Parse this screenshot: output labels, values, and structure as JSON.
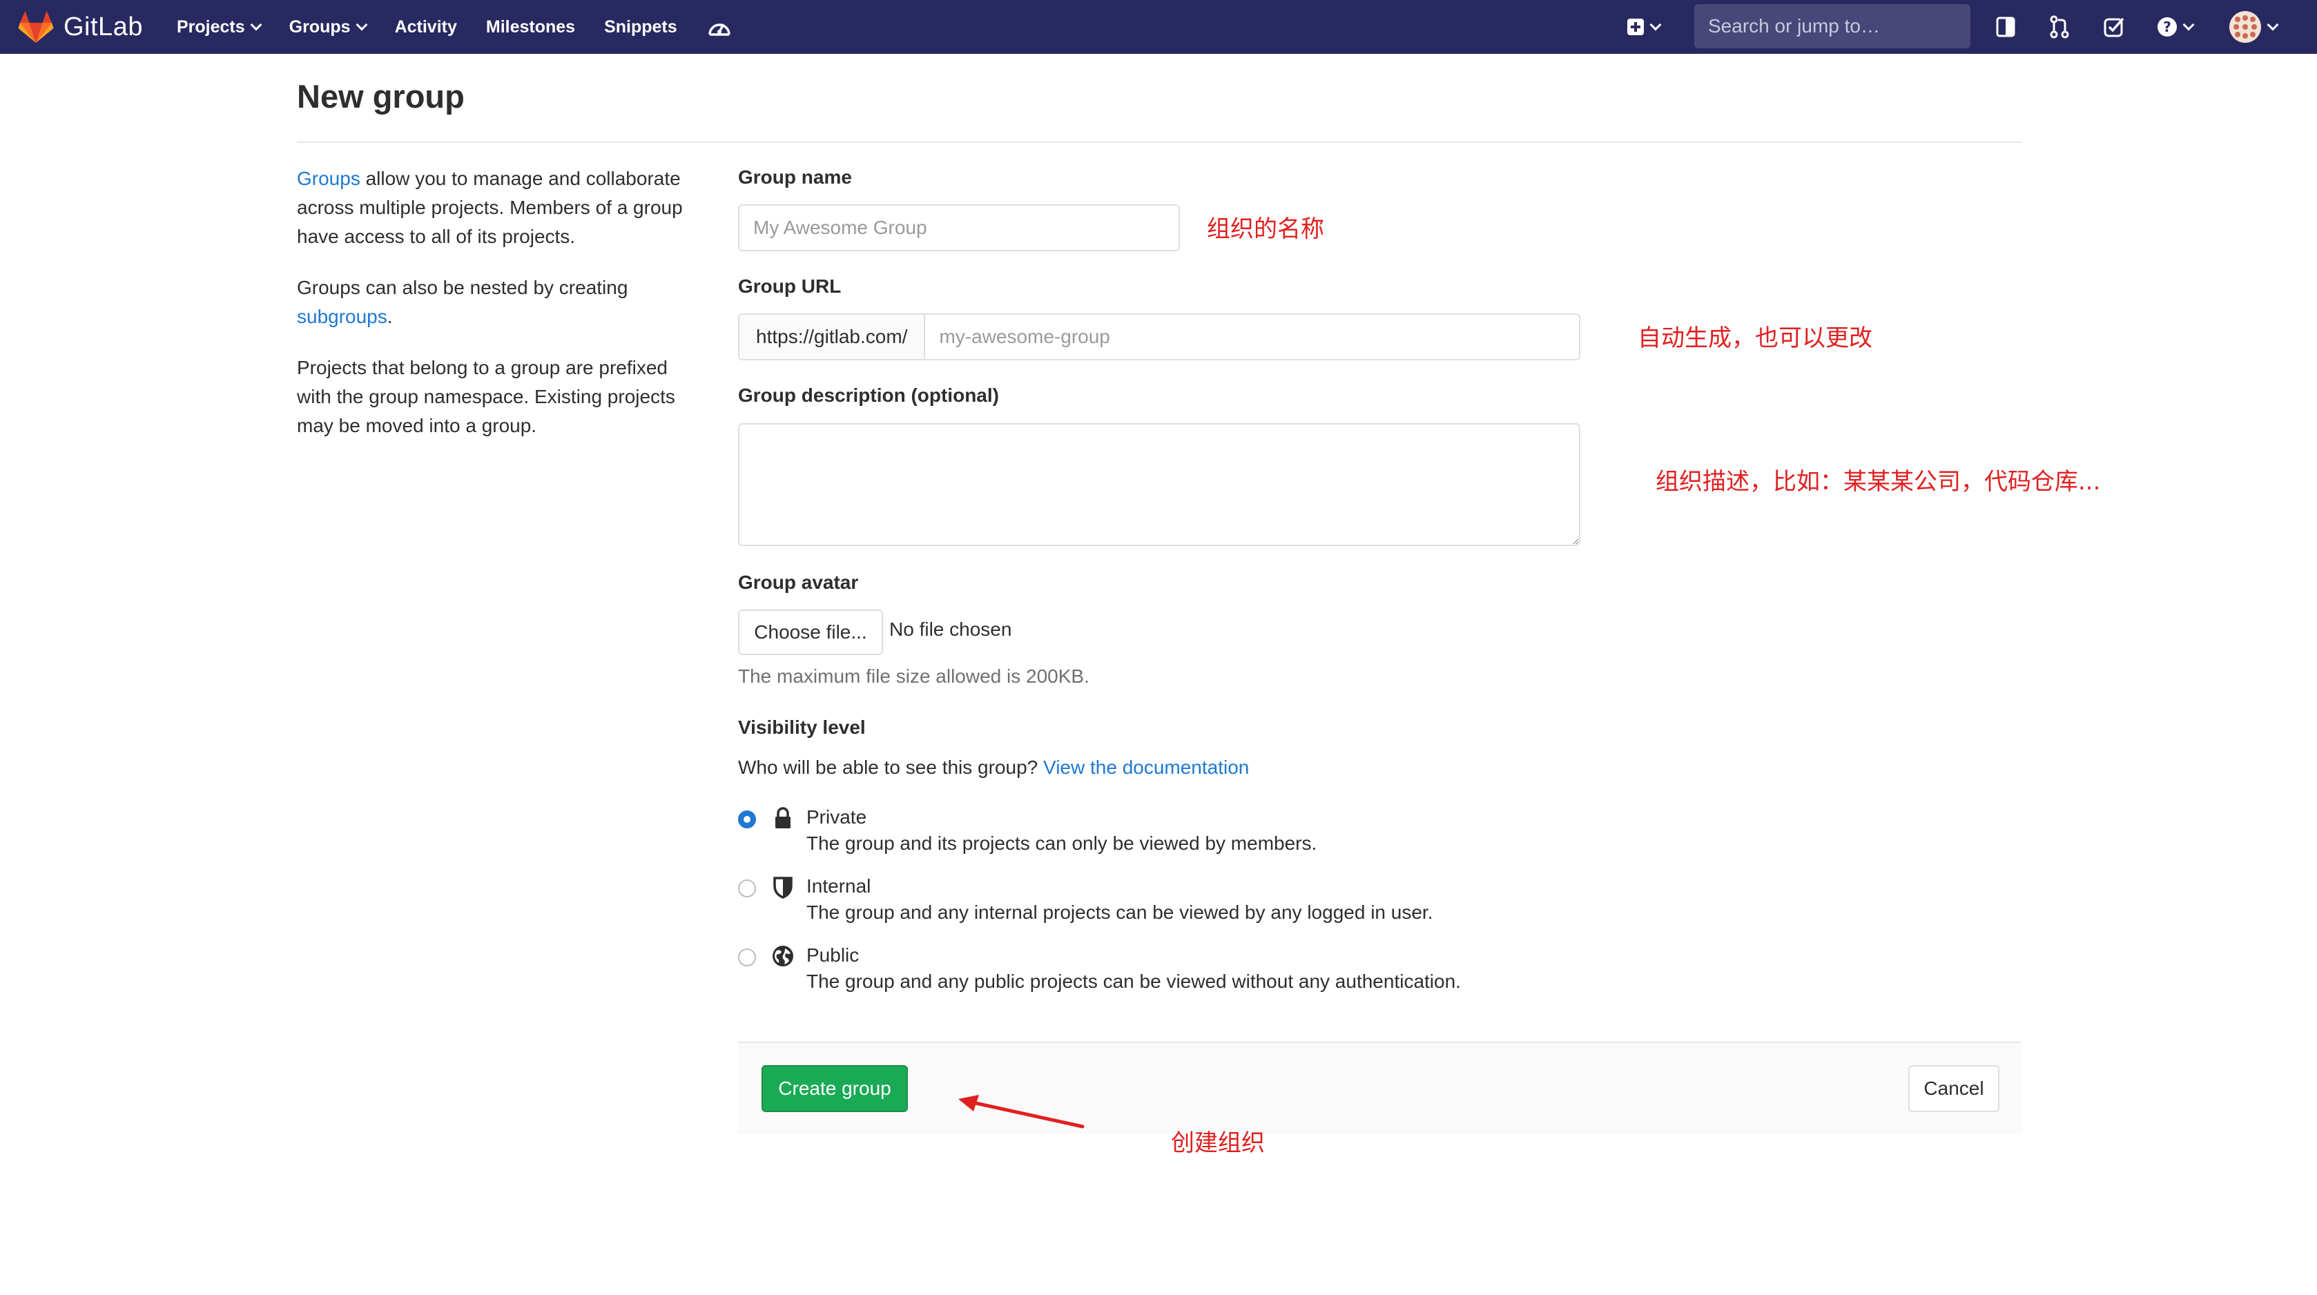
{
  "navbar": {
    "brand": "GitLab",
    "links": [
      {
        "label": "Projects",
        "has_dropdown": true
      },
      {
        "label": "Groups",
        "has_dropdown": true
      },
      {
        "label": "Activity",
        "has_dropdown": false
      },
      {
        "label": "Milestones",
        "has_dropdown": false
      },
      {
        "label": "Snippets",
        "has_dropdown": false
      }
    ],
    "extra_icon": "admin-dashboard-icon",
    "search_placeholder": "Search or jump to…",
    "right_icons": [
      "new-plus-icon",
      "sidebar-toggle-icon",
      "merge-request-icon",
      "todo-check-icon",
      "help-icon",
      "user-avatar"
    ]
  },
  "page": {
    "title": "New group"
  },
  "sidebar": {
    "p1_link": "Groups",
    "p1_text": " allow you to manage and collaborate across multiple projects. Members of a group have access to all of its projects.",
    "p2_text": "Groups can also be nested by creating ",
    "p2_link": "subgroups",
    "p2_end": ".",
    "p3_text": "Projects that belong to a group are prefixed with the group namespace. Existing projects may be moved into a group."
  },
  "form": {
    "group_name_label": "Group name",
    "group_name_placeholder": "My Awesome Group",
    "group_url_label": "Group URL",
    "group_url_prefix": "https://gitlab.com/",
    "group_url_placeholder": "my-awesome-group",
    "description_label": "Group description (optional)",
    "avatar_label": "Group avatar",
    "choose_file": "Choose file...",
    "no_file": "No file chosen",
    "max_size": "The maximum file size allowed is 200KB.",
    "visibility_label": "Visibility level",
    "visibility_question": "Who will be able to see this group? ",
    "visibility_link": "View the documentation",
    "visibility_options": [
      {
        "label": "Private",
        "desc": "The group and its projects can only be viewed by members.",
        "checked": true,
        "icon": "lock-icon"
      },
      {
        "label": "Internal",
        "desc": "The group and any internal projects can be viewed by any logged in user.",
        "checked": false,
        "icon": "shield-icon"
      },
      {
        "label": "Public",
        "desc": "The group and any public projects can be viewed without any authentication.",
        "checked": false,
        "icon": "globe-icon"
      }
    ],
    "create_button": "Create group",
    "cancel_button": "Cancel"
  },
  "annotations": {
    "name": "组织的名称",
    "url": "自动生成，也可以更改",
    "description": "组织描述，比如：某某某公司，代码仓库...",
    "create": "创建组织"
  },
  "colors": {
    "navbar": "#292961",
    "link": "#1f78d1",
    "create_button": "#1aaa55",
    "annotation": "#e02020"
  }
}
